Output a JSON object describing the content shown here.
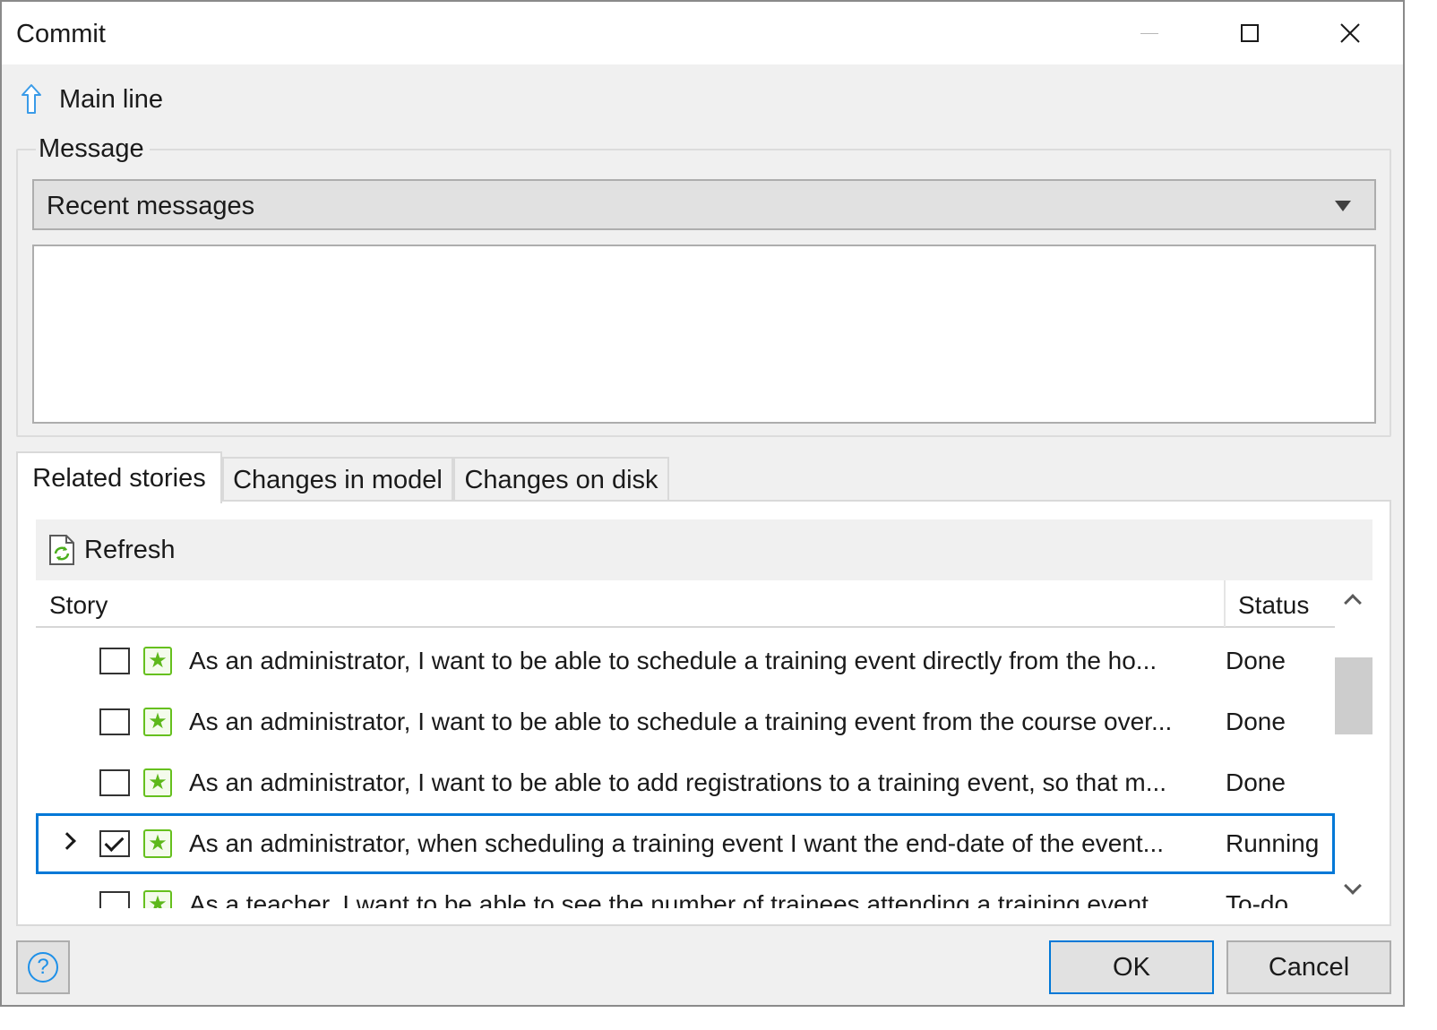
{
  "window": {
    "title": "Commit"
  },
  "branch": {
    "name": "Main line",
    "icon": "up-arrow-icon"
  },
  "message": {
    "group_label": "Message",
    "recent_messages_label": "Recent messages",
    "text": ""
  },
  "tabs": [
    {
      "label": "Related stories",
      "active": true
    },
    {
      "label": "Changes in model",
      "active": false
    },
    {
      "label": "Changes on disk",
      "active": false
    }
  ],
  "stories": {
    "refresh_label": "Refresh",
    "columns": {
      "story": "Story",
      "status": "Status"
    },
    "rows": [
      {
        "text": "As an administrator, I want to be able to schedule a training event directly from the ho...",
        "status": "Done",
        "checked": false,
        "selected": false,
        "expandable": false
      },
      {
        "text": "As an administrator, I want to be able to schedule a training event from the course over...",
        "status": "Done",
        "checked": false,
        "selected": false,
        "expandable": false
      },
      {
        "text": "As an administrator, I want to be able to add registrations to a training event, so that m...",
        "status": "Done",
        "checked": false,
        "selected": false,
        "expandable": false
      },
      {
        "text": "As an administrator, when scheduling a training event I want the end-date of the event...",
        "status": "Running",
        "checked": true,
        "selected": true,
        "expandable": true
      },
      {
        "text": "As a teacher, I want to be able to see the number of trainees attending a training event...",
        "status": "To-do",
        "checked": false,
        "selected": false,
        "expandable": false
      }
    ]
  },
  "buttons": {
    "help": "?",
    "ok": "OK",
    "cancel": "Cancel"
  },
  "colors": {
    "accent": "#0078d7",
    "story_icon": "#66c01e",
    "help_icon": "#1e90e8"
  }
}
